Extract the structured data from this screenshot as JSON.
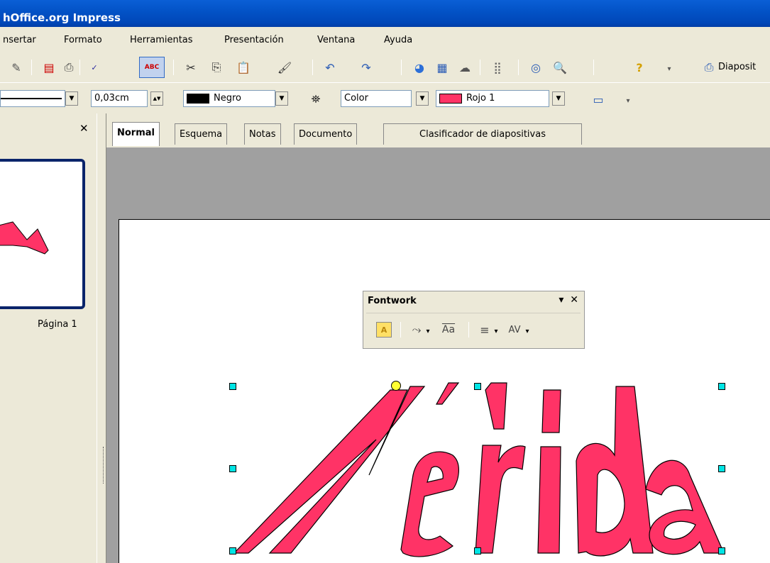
{
  "window": {
    "title": "hOffice.org Impress"
  },
  "menu": [
    {
      "label": "nsertar"
    },
    {
      "label": "Formato"
    },
    {
      "label": "Herramientas"
    },
    {
      "label": "Presentación"
    },
    {
      "label": "Ventana"
    },
    {
      "label": "Ayuda"
    }
  ],
  "toolbar2": {
    "line_width": "0,03cm",
    "line_color": "Negro",
    "area_style": "Color",
    "area_color": "Rojo 1"
  },
  "toolbar1": {
    "slide_button": "Diaposit"
  },
  "panel": {
    "page_label": "Página 1"
  },
  "tabs": [
    {
      "label": "Normal"
    },
    {
      "label": "Esquema"
    },
    {
      "label": "Notas"
    },
    {
      "label": "Documento"
    },
    {
      "label": "Clasificador de diapositivas"
    }
  ],
  "fontwork": {
    "title": "Fontwork"
  },
  "slide": {
    "wordart_text": "Mérida",
    "wordart_color": "#ff3366"
  },
  "colors": {
    "title_bar": "#0353c7",
    "negro": "#000000",
    "rojo1": "#ff3366",
    "workspace": "#a0a0a0"
  }
}
